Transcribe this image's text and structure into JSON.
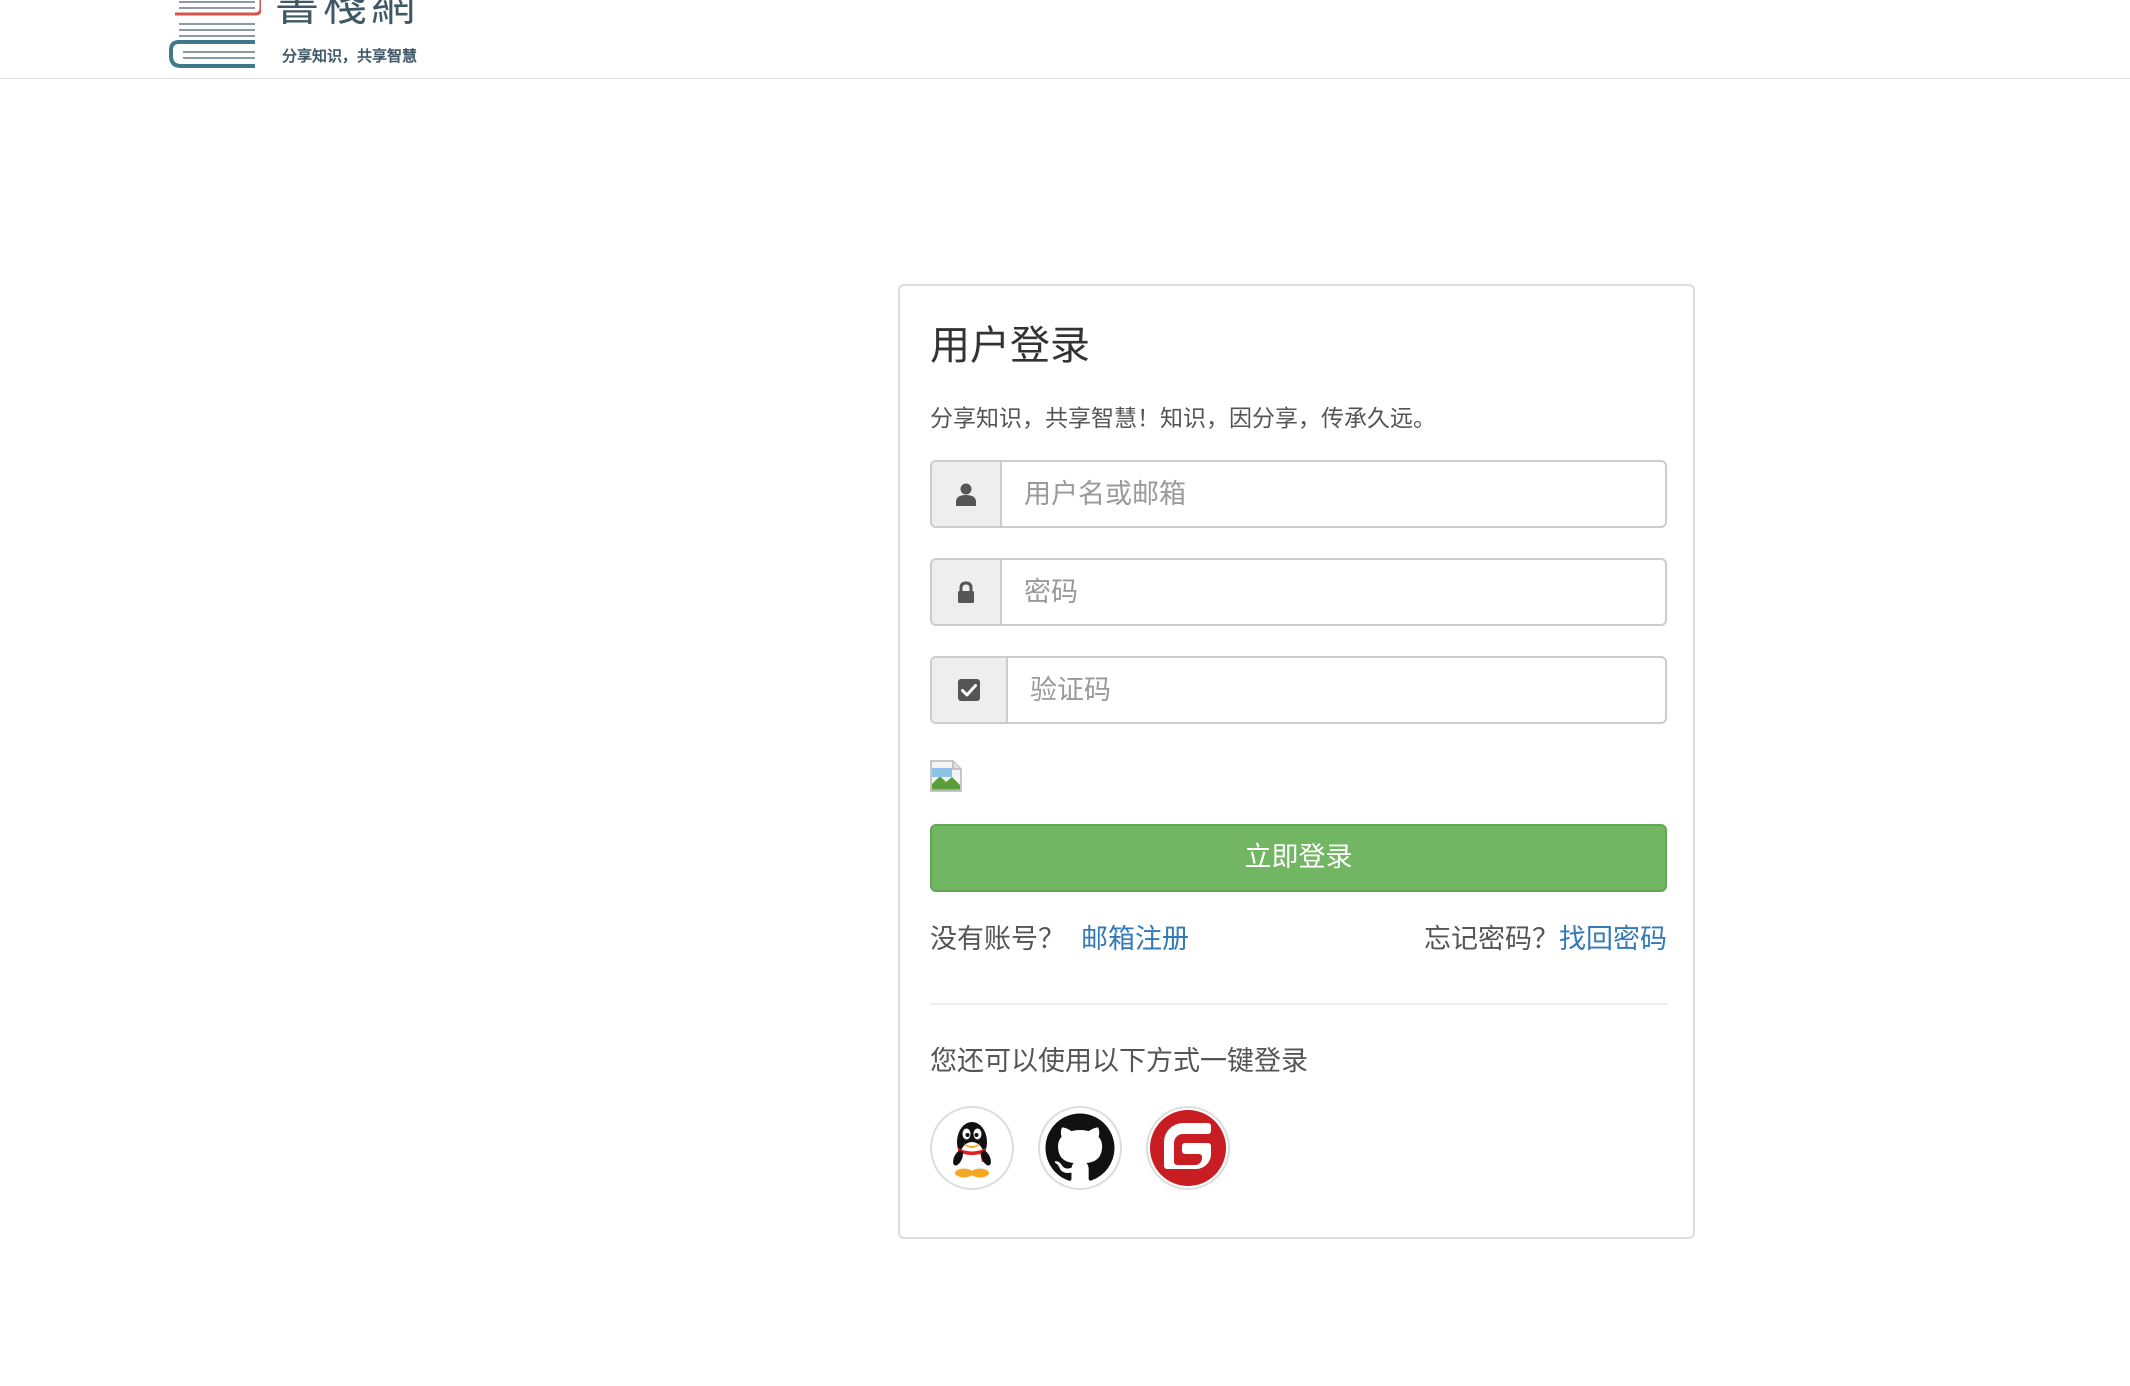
{
  "header": {
    "logo_title": "書棧網",
    "logo_slogan": "分享知识，共享智慧"
  },
  "login": {
    "title": "用户登录",
    "description": "分享知识，共享智慧！知识，因分享，传承久远。",
    "username_placeholder": "用户名或邮箱",
    "password_placeholder": "密码",
    "captcha_placeholder": "验证码",
    "submit_label": "立即登录",
    "no_account_text": "没有账号？",
    "register_link": "邮箱注册",
    "forgot_text": "忘记密码？",
    "recover_link": "找回密码",
    "oauth_tip": "您还可以使用以下方式一键登录"
  },
  "icons": {
    "username": "user-icon",
    "password": "lock-icon",
    "captcha": "checkbox-icon",
    "oauth": [
      "qq-icon",
      "github-icon",
      "gitee-icon"
    ]
  },
  "colors": {
    "primary_button": "#72b663",
    "link": "#337ab7",
    "gitee_red": "#c71d23"
  }
}
